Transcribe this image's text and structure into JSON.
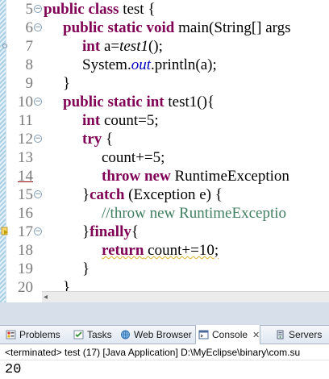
{
  "editor": {
    "lines": [
      {
        "n": "5",
        "fold": "minus"
      },
      {
        "n": "6",
        "fold": "minus"
      },
      {
        "n": "7",
        "fold": ""
      },
      {
        "n": "8",
        "fold": ""
      },
      {
        "n": "9",
        "fold": ""
      },
      {
        "n": "10",
        "fold": "minus"
      },
      {
        "n": "11",
        "fold": ""
      },
      {
        "n": "12",
        "fold": "minus"
      },
      {
        "n": "13",
        "fold": ""
      },
      {
        "n": "14",
        "fold": ""
      },
      {
        "n": "15",
        "fold": "minus"
      },
      {
        "n": "16",
        "fold": ""
      },
      {
        "n": "17",
        "fold": "minus"
      },
      {
        "n": "18",
        "fold": ""
      },
      {
        "n": "19",
        "fold": ""
      },
      {
        "n": "20",
        "fold": ""
      }
    ],
    "code": {
      "l5": {
        "kw1": "public class",
        "rest": " test {"
      },
      "l6": {
        "kw1": "public  static void",
        "rest": " main(String[] args"
      },
      "l7": {
        "kw1": "int",
        "pre": " a=",
        "call": "test1",
        "post": "();"
      },
      "l8": {
        "pre": "System.",
        "field": "out",
        "post": ".println(a);"
      },
      "l9": {
        "text": "}"
      },
      "l10": {
        "kw1": "public static int",
        "rest": " test1(){"
      },
      "l11": {
        "kw1": "int",
        "rest": " count=5;"
      },
      "l12": {
        "kw1": "try",
        "rest": " {"
      },
      "l13": {
        "text": "count+=5;"
      },
      "l14": {
        "kw1": "throw new",
        "rest": " RuntimeException"
      },
      "l15": {
        "pre": "}",
        "kw1": "catch",
        "rest": " (Exception e) {"
      },
      "l16": {
        "comment": "//throw new RuntimeExceptio"
      },
      "l17": {
        "pre": "}",
        "kw1": "finally",
        "rest": "{"
      },
      "l18": {
        "kw1": "return",
        "rest": " count+=10;"
      },
      "l19": {
        "text": "}"
      },
      "l20": {
        "text": "}"
      }
    },
    "gutter_markers": {
      "line7": "override-marker",
      "line17": "warning-marker"
    },
    "current_line": "14"
  },
  "views": {
    "tabs": [
      {
        "label": "Problems",
        "icon": "problems-icon"
      },
      {
        "label": "Tasks",
        "icon": "tasks-icon"
      },
      {
        "label": "Web Browser",
        "icon": "globe-icon"
      },
      {
        "label": "Console",
        "icon": "console-icon",
        "active": true
      },
      {
        "label": "Servers",
        "icon": "servers-icon"
      }
    ],
    "console": {
      "status": "<terminated> test (17) [Java Application] D:\\MyEclipse\\binary\\com.su",
      "output": "20"
    }
  },
  "colors": {
    "keyword": "#7f0055",
    "comment": "#3f7f5f",
    "static_field": "#0000c0",
    "line_number": "#7a7a7a"
  }
}
